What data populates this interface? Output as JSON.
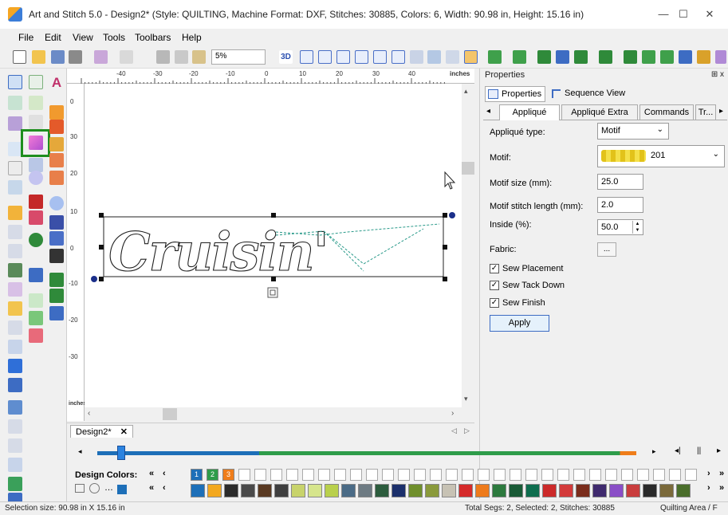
{
  "window": {
    "title": "Art and Stitch 5.0 - Design2* (Style: QUILTING, Machine Format: DXF, Stitches: 30885, Colors: 6, Width: 90.98 in, Height: 15.16 in)",
    "minimize": "—",
    "maximize": "☐",
    "close": "✕"
  },
  "menu": [
    "File",
    "Edit",
    "View",
    "Tools",
    "Toolbars",
    "Help"
  ],
  "toolbar": {
    "zoom_value": "5%"
  },
  "ruler": {
    "unit": "inches",
    "top_ticks": [
      "-40",
      "-30",
      "-20",
      "-10",
      "0",
      "10",
      "20",
      "30",
      "40"
    ],
    "left_ticks": [
      "0",
      "30",
      "20",
      "10",
      "0",
      "-10",
      "-20",
      "-30"
    ],
    "left_unit": "inches"
  },
  "canvas": {
    "design_text": "Cruisin'"
  },
  "document_tab": {
    "label": "Design2*",
    "close": "✕"
  },
  "properties": {
    "header": "Properties",
    "pin": "⊞ x",
    "view_tabs": [
      "Properties",
      "Sequence View"
    ],
    "sub_tabs": [
      "Appliqué",
      "Appliqué Extra",
      "Commands",
      "Tr..."
    ],
    "applique_type_label": "Appliqué type:",
    "applique_type_value": "Motif",
    "motif_label": "Motif:",
    "motif_value": "201",
    "motif_size_label": "Motif size (mm):",
    "motif_size_value": "25.0",
    "motif_stitch_label": "Motif stitch length (mm):",
    "motif_stitch_value": "2.0",
    "inside_label": "Inside (%):",
    "inside_value": "50.0",
    "fabric_label": "Fabric:",
    "fabric_button": "...",
    "sew_placement": "Sew Placement",
    "sew_tack_down": "Sew Tack Down",
    "sew_finish": "Sew Finish",
    "apply": "Apply"
  },
  "colors": {
    "design_colors_label": "Design Colors:",
    "design_color_numbers": [
      "1",
      "2",
      "3"
    ],
    "design_color_hex": [
      "#1d6fb8",
      "#2e9c4a",
      "#ef7d1a"
    ],
    "palette_hex": [
      "#1d6fb8",
      "#f3a81f",
      "#2b2b2b",
      "#4a4a4a",
      "#5a3a22",
      "#3f3f3f",
      "#c8d36b",
      "#d6e58c",
      "#b9d04c",
      "#4b6b86",
      "#6e7b83",
      "#2c5c3d",
      "#1b2f6b",
      "#6f8f2c",
      "#8a9a3b",
      "#c7c2b4",
      "#d52a2a",
      "#ee7b1c",
      "#2d7a3e",
      "#195a36",
      "#0e6d4e",
      "#cc2a2a",
      "#d33a3a",
      "#7a2d1c",
      "#3f2a6e",
      "#8a4ec7",
      "#c93d3d",
      "#2a2a2a",
      "#7b6a3b",
      "#4a6e2b"
    ]
  },
  "status": {
    "selection": "Selection size: 90.98 in X 15.16 in",
    "segments": "Total Segs: 2, Selected: 2, Stitches: 30885",
    "area": "Quilting Area / F"
  },
  "progress": {
    "fraction": 0.045
  }
}
